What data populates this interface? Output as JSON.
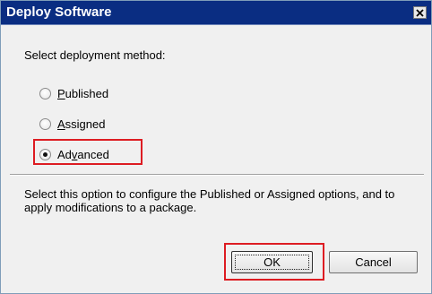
{
  "window": {
    "title": "Deploy Software",
    "close_label": "Close"
  },
  "prompt": "Select deployment method:",
  "options": [
    {
      "prefix": "",
      "accel": "P",
      "rest": "ublished",
      "checked": false
    },
    {
      "prefix": "",
      "accel": "A",
      "rest": "ssigned",
      "checked": false
    },
    {
      "prefix": "Ad",
      "accel": "v",
      "rest": "anced",
      "checked": true
    }
  ],
  "description": "Select this option to configure the Published or Assigned options, and to apply modifications to a package.",
  "buttons": {
    "ok": "OK",
    "cancel": "Cancel"
  },
  "colors": {
    "titlebar": "#0a2d82",
    "highlight": "#dd1c22"
  }
}
